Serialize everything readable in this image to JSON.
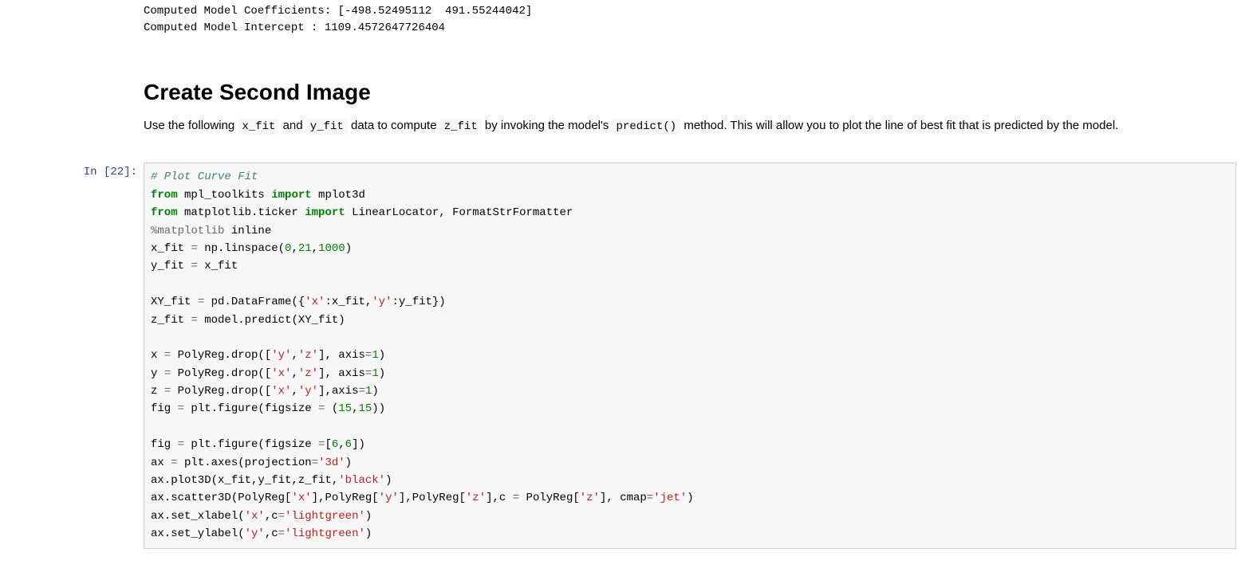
{
  "output_top": {
    "line1": "Computed Model Coefficients: [-498.52495112  491.55244042]",
    "line2": "Computed Model Intercept : 1109.4572647726404"
  },
  "markdown": {
    "heading": "Create Second Image",
    "p_before_1": "Use the following ",
    "code_1": "x_fit",
    "p_sep_1": " and ",
    "code_2": "y_fit",
    "p_sep_2": " data to compute ",
    "code_3": "z_fit",
    "p_sep_3": " by invoking the model's ",
    "code_4": "predict()",
    "p_after": " method. This will allow you to plot the line of best fit that is predicted by the model."
  },
  "cell22": {
    "prompt": "In [22]:",
    "l1_comment": "# Plot Curve Fit",
    "l2_kw1": "from",
    "l2_mod": " mpl_toolkits ",
    "l2_kw2": "import",
    "l2_imp": " mplot3d",
    "l3_kw1": "from",
    "l3_mod": " matplotlib.ticker ",
    "l3_kw2": "import",
    "l3_imp": " LinearLocator, FormatStrFormatter",
    "l4_magic": "%matplotlib",
    "l4_arg": " inline",
    "l5_a": "x_fit ",
    "l5_eq": "=",
    "l5_b": " np.linspace(",
    "l5_n1": "0",
    "l5_c": ",",
    "l5_n2": "21",
    "l5_d": ",",
    "l5_n3": "1000",
    "l5_e": ")",
    "l6_a": "y_fit ",
    "l6_eq": "=",
    "l6_b": " x_fit",
    "l8_a": "XY_fit ",
    "l8_eq": "=",
    "l8_b": " pd.DataFrame({",
    "l8_s1": "'x'",
    "l8_c": ":x_fit,",
    "l8_s2": "'y'",
    "l8_d": ":y_fit})",
    "l9_a": "z_fit ",
    "l9_eq": "=",
    "l9_b": " model.predict(XY_fit)",
    "l11_a": "x ",
    "l11_eq": "=",
    "l11_b": " PolyReg.drop([",
    "l11_s1": "'y'",
    "l11_c": ",",
    "l11_s2": "'z'",
    "l11_d": "], axis",
    "l11_eq2": "=",
    "l11_n": "1",
    "l11_e": ")",
    "l12_a": "y ",
    "l12_eq": "=",
    "l12_b": " PolyReg.drop([",
    "l12_s1": "'x'",
    "l12_c": ",",
    "l12_s2": "'z'",
    "l12_d": "], axis",
    "l12_eq2": "=",
    "l12_n": "1",
    "l12_e": ")",
    "l13_a": "z ",
    "l13_eq": "=",
    "l13_b": " PolyReg.drop([",
    "l13_s1": "'x'",
    "l13_c": ",",
    "l13_s2": "'y'",
    "l13_d": "],axis",
    "l13_eq2": "=",
    "l13_n": "1",
    "l13_e": ")",
    "l14_a": "fig ",
    "l14_eq": "=",
    "l14_b": " plt.figure(figsize ",
    "l14_eq2": "=",
    "l14_c": " (",
    "l14_n1": "15",
    "l14_d": ",",
    "l14_n2": "15",
    "l14_e": "))",
    "l16_a": "fig ",
    "l16_eq": "=",
    "l16_b": " plt.figure(figsize ",
    "l16_eq2": "=",
    "l16_c": "[",
    "l16_n1": "6",
    "l16_d": ",",
    "l16_n2": "6",
    "l16_e": "])",
    "l17_a": "ax ",
    "l17_eq": "=",
    "l17_b": " plt.axes(projection",
    "l17_eq2": "=",
    "l17_s": "'3d'",
    "l17_c": ")",
    "l18_a": "ax.plot3D(x_fit,y_fit,z_fit,",
    "l18_s": "'black'",
    "l18_b": ")",
    "l19_a": "ax.scatter3D(PolyReg[",
    "l19_s1": "'x'",
    "l19_b": "],PolyReg[",
    "l19_s2": "'y'",
    "l19_c": "],PolyReg[",
    "l19_s3": "'z'",
    "l19_d": "],c ",
    "l19_eq": "=",
    "l19_e": " PolyReg[",
    "l19_s4": "'z'",
    "l19_f": "], cmap",
    "l19_eq2": "=",
    "l19_s5": "'jet'",
    "l19_g": ")",
    "l20_a": "ax.set_xlabel(",
    "l20_s1": "'x'",
    "l20_b": ",c",
    "l20_eq": "=",
    "l20_s2": "'lightgreen'",
    "l20_c": ")",
    "l21_a": "ax.set_ylabel(",
    "l21_s1": "'y'",
    "l21_b": ",c",
    "l21_eq": "=",
    "l21_s2": "'lightgreen'",
    "l21_c": ")"
  }
}
